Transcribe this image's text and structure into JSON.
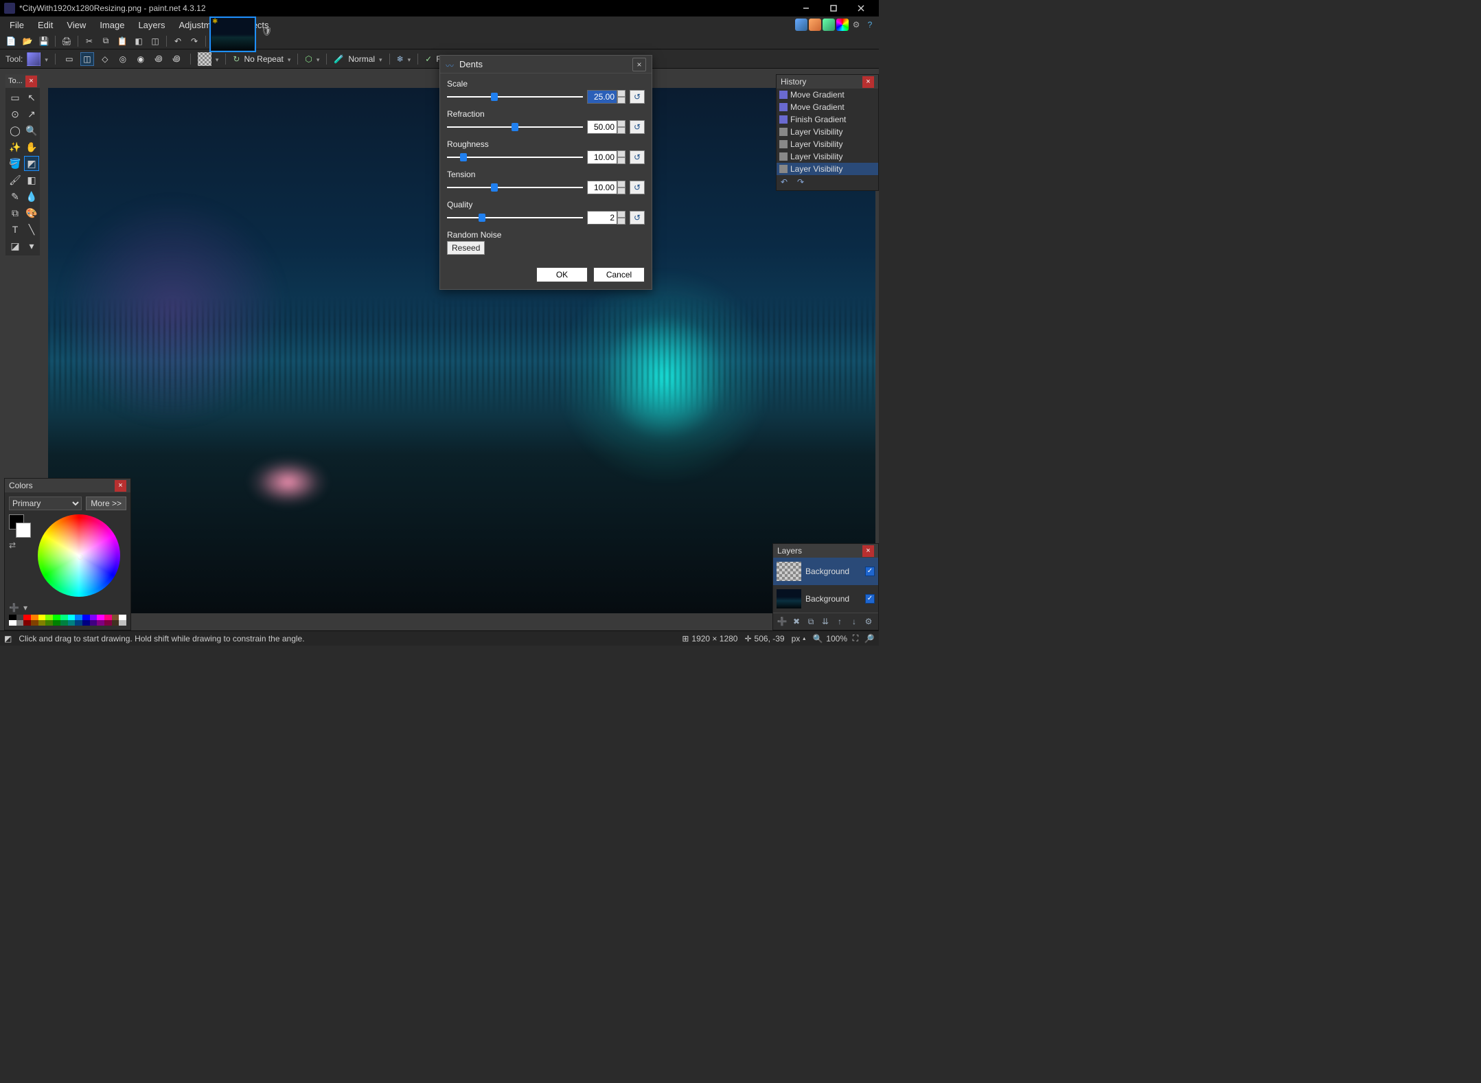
{
  "titlebar": {
    "title": "*CityWith1920x1280Resizing.png - paint.net 4.3.12"
  },
  "menubar": {
    "items": [
      "File",
      "Edit",
      "View",
      "Image",
      "Layers",
      "Adjustments",
      "Effects"
    ]
  },
  "options": {
    "tool_label": "Tool:",
    "norepeat": "No Repeat",
    "blendmode": "Normal",
    "finish": "Finish"
  },
  "tools_panel": {
    "title": "To..."
  },
  "dialog": {
    "title": "Dents",
    "params": [
      {
        "label": "Scale",
        "value": "25.00",
        "pos": 35,
        "selected": true
      },
      {
        "label": "Refraction",
        "value": "50.00",
        "pos": 50
      },
      {
        "label": "Roughness",
        "value": "10.00",
        "pos": 12
      },
      {
        "label": "Tension",
        "value": "10.00",
        "pos": 35
      },
      {
        "label": "Quality",
        "value": "2",
        "pos": 26
      }
    ],
    "random_noise_label": "Random Noise",
    "reseed": "Reseed",
    "ok": "OK",
    "cancel": "Cancel"
  },
  "history": {
    "title": "History",
    "items": [
      {
        "label": "Move Gradient",
        "c": "#6a6ad0"
      },
      {
        "label": "Move Gradient",
        "c": "#6a6ad0"
      },
      {
        "label": "Finish Gradient",
        "c": "#6a6ad0"
      },
      {
        "label": "Layer Visibility",
        "c": "#888"
      },
      {
        "label": "Layer Visibility",
        "c": "#888"
      },
      {
        "label": "Layer Visibility",
        "c": "#888"
      },
      {
        "label": "Layer Visibility",
        "c": "#888",
        "sel": true
      }
    ]
  },
  "layers": {
    "title": "Layers",
    "items": [
      {
        "name": "Background",
        "checked": true,
        "sel": true,
        "checkerboard": true
      },
      {
        "name": "Background",
        "checked": true
      }
    ]
  },
  "colors": {
    "title": "Colors",
    "primary_label": "Primary",
    "more_label": "More >>",
    "palette_row1": [
      "#000",
      "#404040",
      "#ff0000",
      "#ff8000",
      "#ffff00",
      "#80ff00",
      "#00ff00",
      "#00ff80",
      "#00ffff",
      "#0080ff",
      "#0000ff",
      "#8000ff",
      "#ff00ff",
      "#ff0080",
      "#7a5230",
      "#ffffff"
    ],
    "palette_row2": [
      "#fff",
      "#808080",
      "#800000",
      "#804000",
      "#808000",
      "#408000",
      "#008000",
      "#008040",
      "#008080",
      "#004080",
      "#000080",
      "#400080",
      "#800080",
      "#800040",
      "#403020",
      "#c0c0c0"
    ]
  },
  "status": {
    "hint": "Click and drag to start drawing. Hold shift while drawing to constrain the angle.",
    "size": "1920 × 1280",
    "cursor": "506, -39",
    "unit": "px",
    "zoom": "100%"
  }
}
